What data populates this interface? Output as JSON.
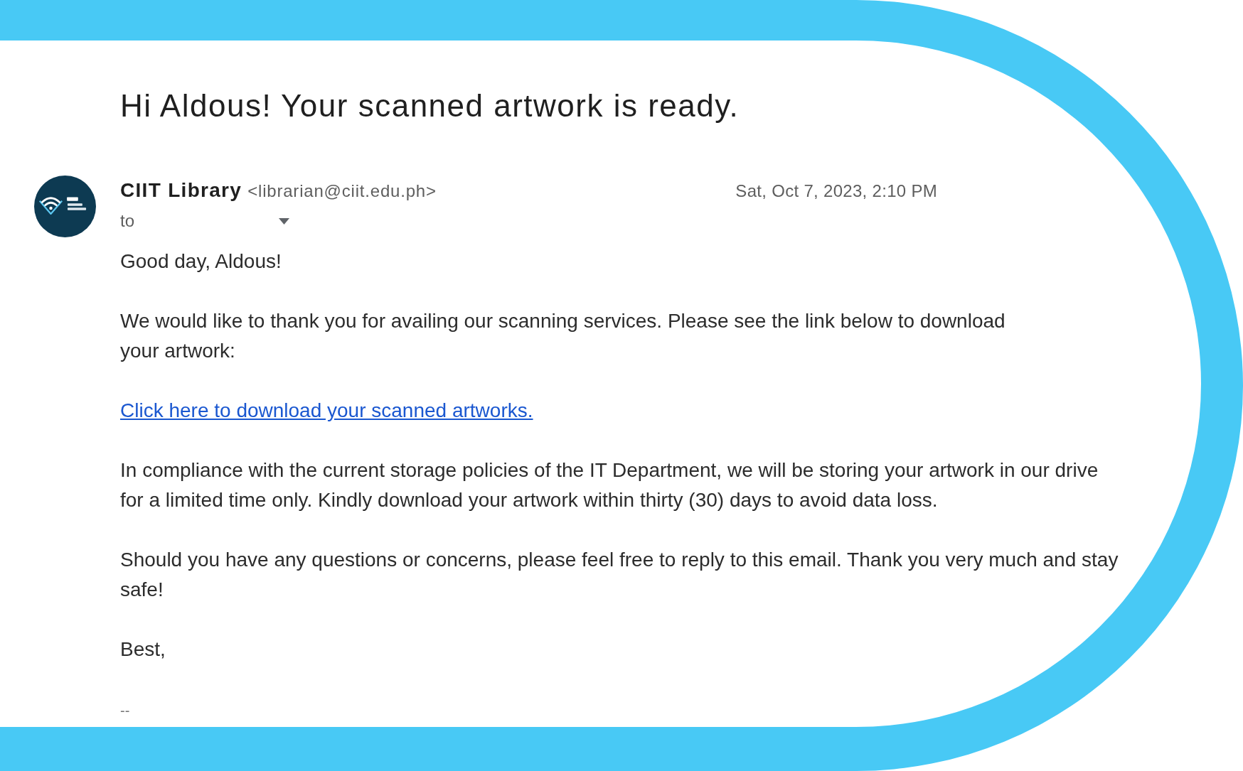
{
  "email": {
    "subject": "Hi Aldous! Your scanned artwork is ready.",
    "sender": {
      "name": "CIIT Library",
      "address": "<librarian@ciit.edu.ph>"
    },
    "date": "Sat, Oct 7, 2023, 2:10 PM",
    "recipient_label": "to",
    "body": [
      {
        "kind": "text",
        "text": "Good day, Aldous!"
      },
      {
        "kind": "text",
        "text": "We would like to thank you for availing our scanning services. Please see the link below to download\nyour artwork:"
      },
      {
        "kind": "link",
        "text": "Click here to download your scanned artworks."
      },
      {
        "kind": "text",
        "text": "In compliance with the current storage policies of the IT Department, we will be storing your artwork in our drive for a limited time only. Kindly download your artwork within thirty (30) days to avoid data loss."
      },
      {
        "kind": "text",
        "text": "Should you have any questions or concerns, please feel free to reply to this email. Thank you very much and stay safe!"
      },
      {
        "kind": "text",
        "text": "Best,"
      },
      {
        "kind": "signature",
        "text": "--"
      }
    ]
  }
}
